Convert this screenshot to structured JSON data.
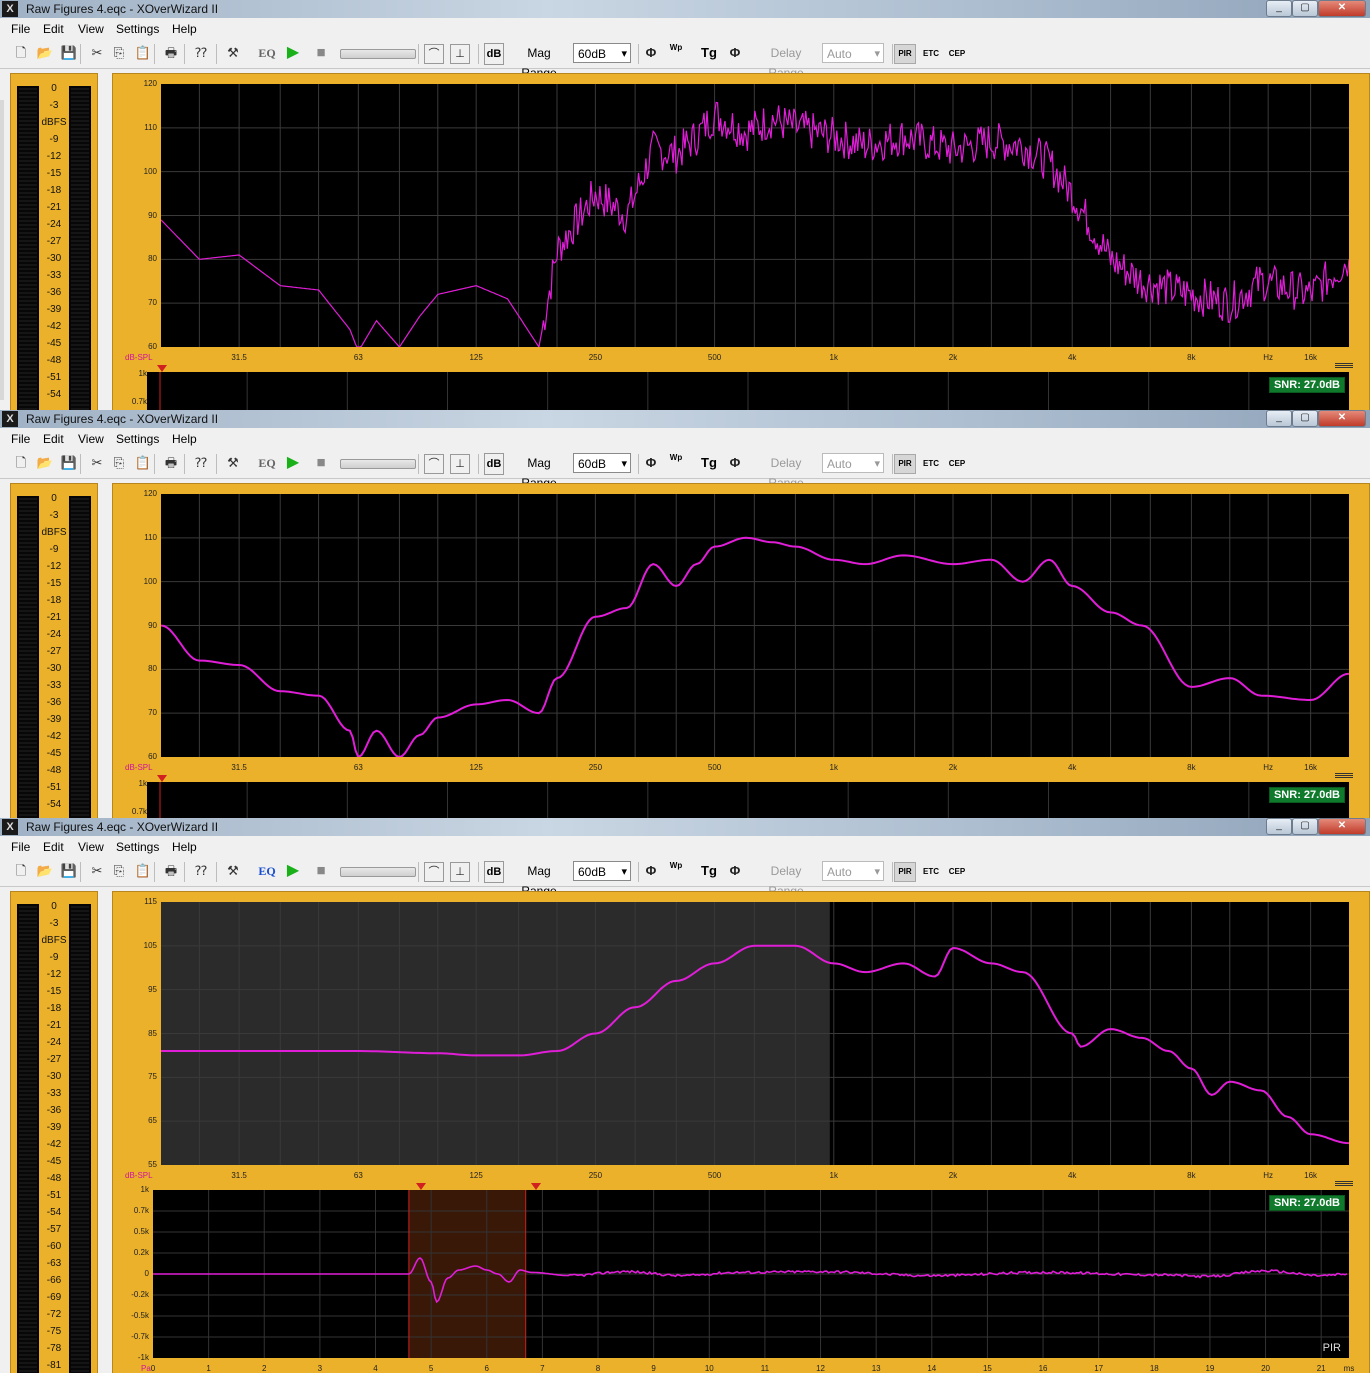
{
  "windows": [
    {
      "title": "Raw Figures 4.eqc - XOverWizard II",
      "eq_active": false,
      "yticks": [
        "120",
        "110",
        "100",
        "90",
        "80",
        "70",
        "60"
      ],
      "snr": "SNR: 27.0dB",
      "ir_yticks": [
        "1k",
        "0.7k"
      ],
      "curve": "raw"
    },
    {
      "title": "Raw Figures 4.eqc - XOverWizard II",
      "eq_active": false,
      "yticks": [
        "120",
        "110",
        "100",
        "90",
        "80",
        "70",
        "60"
      ],
      "snr": "SNR: 27.0dB",
      "ir_yticks": [
        "1k",
        "0.7k"
      ],
      "curve": "smoothed"
    },
    {
      "title": "Raw Figures 4.eqc - XOverWizard II",
      "eq_active": true,
      "yticks": [
        "115",
        "105",
        "95",
        "85",
        "75",
        "65",
        "55"
      ],
      "snr": "SNR: 27.0dB",
      "ir_yticks": [
        "1k",
        "0.7k",
        "0.5k",
        "0.2k",
        "0",
        "-0.2k",
        "-0.5k",
        "-0.7k",
        "-1k"
      ],
      "ir_xticks": [
        "0",
        "1",
        "2",
        "3",
        "4",
        "5",
        "6",
        "7",
        "8",
        "9",
        "10",
        "11",
        "12",
        "13",
        "14",
        "15",
        "16",
        "17",
        "18",
        "19",
        "20",
        "21",
        "ms"
      ],
      "ir_unit": "Pa",
      "pir_label": "PIR",
      "curve": "gated"
    }
  ],
  "menu": [
    "File",
    "Edit",
    "View",
    "Settings",
    "Help"
  ],
  "toolbar": {
    "eq": "EQ",
    "db": "dB",
    "mag_range_label": "Mag Range",
    "mag_range_value": "60dB",
    "delay_range_label": "Delay Range",
    "delay_range_value": "Auto",
    "pir": "PIR",
    "etc": "ETC",
    "cep": "CEP",
    "tg": "Tg",
    "wp": "Wp"
  },
  "xticks": [
    "31.5",
    "63",
    "125",
    "250",
    "500",
    "1k",
    "2k",
    "4k",
    "8k",
    "Hz",
    "16k"
  ],
  "y_unit": "dB-SPL",
  "meter": {
    "unit": "dBFS",
    "scale": [
      "0",
      "-3",
      "dBFS",
      "-9",
      "-12",
      "-15",
      "-18",
      "-21",
      "-24",
      "-27",
      "-30",
      "-33",
      "-36",
      "-39",
      "-42",
      "-45",
      "-48",
      "-51",
      "-54",
      "-57",
      "-60",
      "-63",
      "-66",
      "-69",
      "-72",
      "-75",
      "-78",
      "-81"
    ]
  },
  "chart_data": [
    {
      "type": "line",
      "xlabel": "Hz",
      "ylabel": "dB-SPL",
      "x_scale": "log",
      "xlim": [
        20,
        20000
      ],
      "ylim": [
        60,
        120
      ],
      "series": [
        {
          "x": [
            20,
            25,
            31.5,
            40,
            50,
            60,
            63,
            70,
            80,
            90,
            100,
            125,
            150,
            180,
            200,
            250,
            300,
            350,
            400,
            450,
            500,
            600,
            700,
            800,
            1000,
            1200,
            1500,
            2000,
            2500,
            3000,
            3500,
            4000,
            5000,
            6000,
            8000,
            10000,
            12000,
            16000,
            20000
          ],
          "y": [
            89,
            80,
            81,
            74,
            73,
            64,
            59,
            66,
            60,
            67,
            72,
            74,
            71,
            60,
            82,
            95,
            90,
            105,
            104,
            108,
            113,
            109,
            112,
            110,
            108,
            106,
            108,
            105,
            107,
            106,
            102,
            95,
            80,
            75,
            72,
            70,
            75,
            72,
            80
          ]
        }
      ]
    },
    {
      "type": "line",
      "xlabel": "Hz",
      "ylabel": "dB-SPL",
      "x_scale": "log",
      "xlim": [
        20,
        20000
      ],
      "ylim": [
        60,
        120
      ],
      "series": [
        {
          "x": [
            20,
            25,
            31.5,
            40,
            50,
            60,
            63,
            70,
            80,
            90,
            100,
            125,
            150,
            180,
            200,
            250,
            300,
            350,
            400,
            450,
            500,
            600,
            700,
            800,
            1000,
            1200,
            1500,
            2000,
            2500,
            3000,
            3500,
            4000,
            5000,
            6000,
            8000,
            10000,
            12000,
            16000,
            20000
          ],
          "y": [
            90,
            82,
            81,
            75,
            74,
            66,
            60,
            66,
            60,
            65,
            69,
            72,
            73,
            70,
            78,
            92,
            94,
            104,
            99,
            104,
            108,
            110,
            109,
            108,
            105,
            104,
            106,
            104,
            105,
            100,
            105,
            99,
            93,
            90,
            76,
            78,
            74,
            73,
            79
          ]
        }
      ]
    },
    {
      "type": "line",
      "xlabel": "Hz",
      "ylabel": "dB-SPL",
      "x_scale": "log",
      "xlim": [
        20,
        20000
      ],
      "ylim": [
        55,
        115
      ],
      "series": [
        {
          "x": [
            20,
            31.5,
            63,
            100,
            125,
            160,
            200,
            250,
            315,
            400,
            500,
            630,
            800,
            1000,
            1200,
            1500,
            1800,
            2000,
            2500,
            3000,
            4000,
            4200,
            5000,
            6000,
            7000,
            8000,
            9000,
            10000,
            12000,
            14000,
            16000,
            20000
          ],
          "y": [
            81,
            81,
            81,
            80.5,
            80,
            80,
            81,
            85,
            91,
            97,
            101,
            105,
            105,
            101,
            99,
            101,
            98,
            104.5,
            101,
            99,
            85,
            82,
            86,
            84,
            81,
            77,
            71,
            74,
            72,
            66,
            62,
            60
          ]
        }
      ]
    }
  ],
  "impulse": {
    "type": "line",
    "xlabel": "ms",
    "ylabel": "Pa",
    "xlim": [
      0,
      21.5
    ],
    "gate_ms": [
      4.6,
      6.7
    ],
    "x": [
      0,
      1,
      2,
      3,
      4,
      4.6,
      4.8,
      5.0,
      5.1,
      5.3,
      5.5,
      5.8,
      6.0,
      6.2,
      6.4,
      6.6,
      6.8,
      7.5,
      8.5,
      9.5,
      10.5,
      12,
      14,
      16,
      18,
      19,
      20,
      21,
      21.5
    ],
    "y": [
      0,
      0,
      0,
      0,
      0,
      0,
      0.2,
      -0.1,
      -0.35,
      -0.05,
      0.05,
      0.1,
      0.05,
      0.0,
      -0.1,
      0.05,
      0.02,
      -0.02,
      0.03,
      -0.02,
      0.02,
      0.03,
      -0.02,
      0.02,
      -0.01,
      -0.03,
      0.04,
      -0.02,
      0
    ]
  }
}
